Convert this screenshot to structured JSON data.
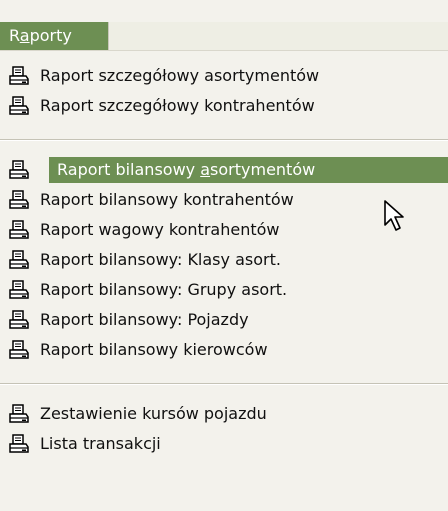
{
  "menu": {
    "title_prefix": "R",
    "title_underlined": "a",
    "title_suffix": "porty",
    "items": [
      {
        "label": "Raport szczegółowy asortymentów",
        "icon": "printer-icon"
      },
      {
        "label": "Raport szczegółowy kontrahentów",
        "icon": "printer-icon"
      },
      {
        "label_prefix": "Raport bilansowy ",
        "label_underlined": "a",
        "label_suffix": "sortymentów",
        "icon": "printer-icon",
        "active": true
      },
      {
        "label": "Raport bilansowy kontrahentów",
        "icon": "printer-icon"
      },
      {
        "label": "Raport wagowy kontrahentów",
        "icon": "printer-icon"
      },
      {
        "label": "Raport bilansowy: Klasy asort.",
        "icon": "printer-icon"
      },
      {
        "label": "Raport bilansowy: Grupy asort.",
        "icon": "printer-icon"
      },
      {
        "label": "Raport bilansowy: Pojazdy",
        "icon": "printer-icon"
      },
      {
        "label": "Raport bilansowy kierowców",
        "icon": "printer-icon"
      },
      {
        "label": "Zestawienie kursów pojazdu",
        "icon": "printer-icon"
      },
      {
        "label": "Lista transakcji",
        "icon": "printer-icon"
      }
    ]
  },
  "colors": {
    "highlight": "#6d8f53",
    "menu_bg": "#f3f2ec",
    "text": "#101010"
  }
}
